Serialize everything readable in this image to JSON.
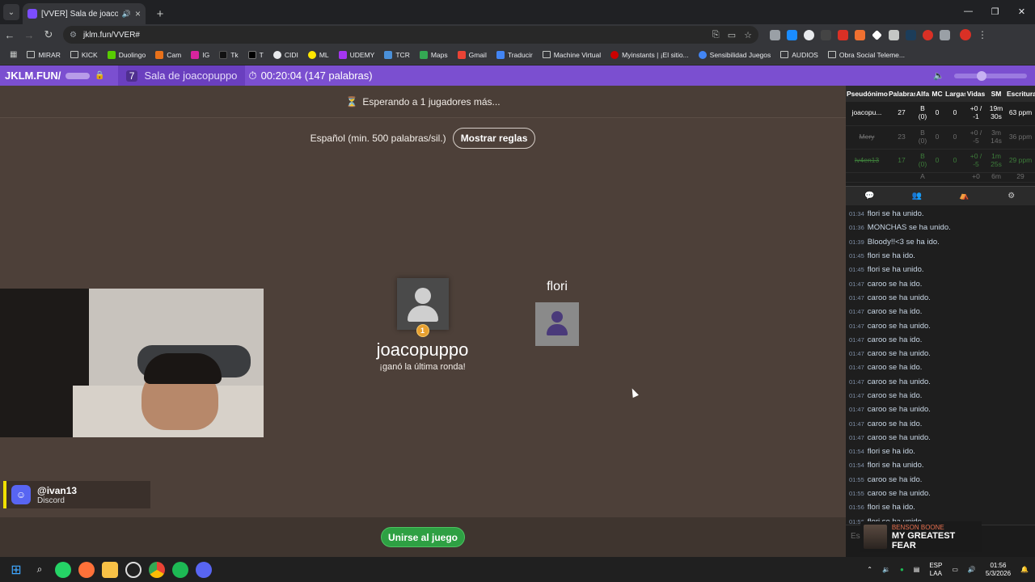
{
  "browser": {
    "tab_title": "[VVER] Sala de joacopuppo",
    "url": "jklm.fun/VVER#",
    "bookmarks": [
      "MIRAR",
      "KICK",
      "Duolingo",
      "Cam",
      "IG",
      "Tk",
      "T",
      "CIDI",
      "ML",
      "UDEMY",
      "TCR",
      "Maps",
      "Gmail",
      "Traducir",
      "Machine Virtual",
      "Myinstants | ¡El sitio...",
      "Sensibilidad Juegos",
      "AUDIOS",
      "Obra Social Teleme..."
    ]
  },
  "game_header": {
    "site": "JKLM.FUN/",
    "room_number": "7",
    "room_name": "Sala de joacopuppo",
    "timer": "00:20:04 (147 palabras)"
  },
  "main": {
    "waiting": "Esperando a 1 jugadores más...",
    "language_rule": "Español (min. 500 palabras/sil.)",
    "rules_button": "Mostrar reglas",
    "winner_name": "joacopuppo",
    "winner_subtitle": "¡ganó la última ronda!",
    "winner_rank": "1",
    "other_player": "flori",
    "join_button": "Unirse al juego"
  },
  "overlay": {
    "discord_handle": "@ivan13",
    "discord_label": "Discord",
    "music_artist": "BENSON BOONE",
    "music_title": "MY GREATEST FEAR"
  },
  "scoreboard": {
    "headers": [
      "Pseudónimo",
      "Palabras",
      "Alfa",
      "MC",
      "Largas",
      "Vidas",
      "SM",
      "Escritura"
    ],
    "rows": [
      [
        "joacopu...",
        "27",
        "B (0)",
        "0",
        "0",
        "+0 / -1",
        "19m 30s",
        "63 ppm"
      ],
      [
        "Mery",
        "23",
        "B (0)",
        "0",
        "0",
        "+0 / -5",
        "3m 14s",
        "36 ppm"
      ],
      [
        "Iv4en13",
        "17",
        "B (0)",
        "0",
        "0",
        "+0 / -5",
        "1m 25s",
        "29 ppm"
      ],
      [
        "",
        "",
        "A",
        "",
        "",
        "+0",
        "6m",
        "29"
      ]
    ]
  },
  "chat": [
    {
      "time": "01:34",
      "msg": "flori se ha unido."
    },
    {
      "time": "01:36",
      "msg": "MONCHAS se ha unido."
    },
    {
      "time": "01:39",
      "msg": "Bloody!!<3 se ha ido."
    },
    {
      "time": "01:45",
      "msg": "flori se ha ido."
    },
    {
      "time": "01:45",
      "msg": "flori se ha unido."
    },
    {
      "time": "01:47",
      "msg": "caroo se ha ido."
    },
    {
      "time": "01:47",
      "msg": "caroo se ha unido."
    },
    {
      "time": "01:47",
      "msg": "caroo se ha ido."
    },
    {
      "time": "01:47",
      "msg": "caroo se ha unido."
    },
    {
      "time": "01:47",
      "msg": "caroo se ha ido."
    },
    {
      "time": "01:47",
      "msg": "caroo se ha unido."
    },
    {
      "time": "01:47",
      "msg": "caroo se ha ido."
    },
    {
      "time": "01:47",
      "msg": "caroo se ha unido."
    },
    {
      "time": "01:47",
      "msg": "caroo se ha ido."
    },
    {
      "time": "01:47",
      "msg": "caroo se ha unido."
    },
    {
      "time": "01:47",
      "msg": "caroo se ha ido."
    },
    {
      "time": "01:47",
      "msg": "caroo se ha unido."
    },
    {
      "time": "01:54",
      "msg": "flori se ha ido."
    },
    {
      "time": "01:54",
      "msg": "flori se ha unido."
    },
    {
      "time": "01:55",
      "msg": "caroo se ha ido."
    },
    {
      "time": "01:55",
      "msg": "caroo se ha unido."
    },
    {
      "time": "01:56",
      "msg": "flori se ha ido."
    },
    {
      "time": "01:56",
      "msg": "flori se ha unido."
    }
  ],
  "chat_placeholder": "Es",
  "taskbar": {
    "lang_top": "ESP",
    "lang_bottom": "LAA",
    "time": "01:56",
    "date": "5/3/2026"
  },
  "colors": {
    "header_purple": "#7b4fd0",
    "game_bg": "#4d4039",
    "join_green": "#2ea043"
  }
}
